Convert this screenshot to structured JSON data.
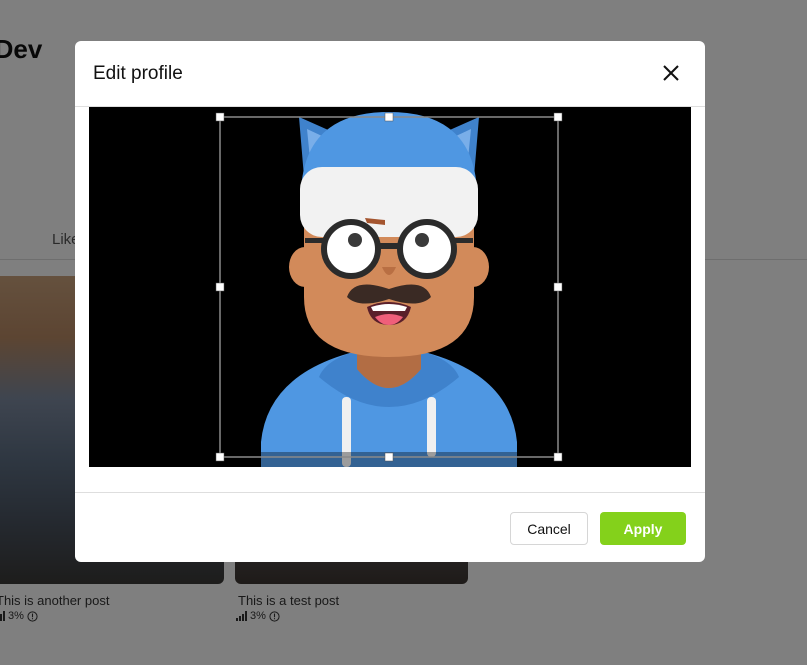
{
  "background_page": {
    "profile_name_fragment": "tDev",
    "tab_likes_fragment": "Like",
    "posts": [
      {
        "caption": "This is another post",
        "stat": "3%"
      },
      {
        "caption": "This is a test post",
        "stat": "3%"
      }
    ]
  },
  "modal": {
    "title": "Edit profile",
    "cancel_label": "Cancel",
    "apply_label": "Apply"
  },
  "colors": {
    "apply_green": "#84d11b",
    "overlay": "rgba(0,0,0,0.5)",
    "avatar_blue": "#4f97e2"
  },
  "icons": [
    "close-icon",
    "bar-chart-icon",
    "info-icon",
    "crop-handle"
  ]
}
